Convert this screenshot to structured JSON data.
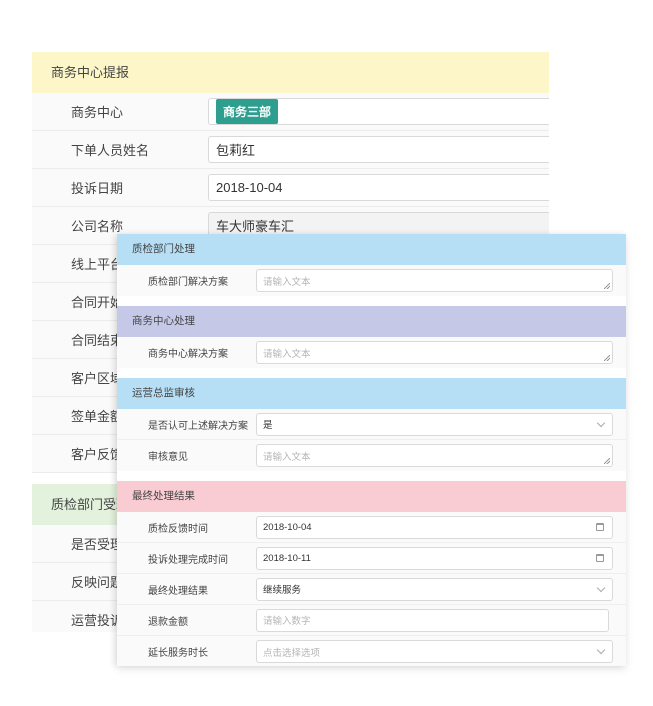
{
  "back_form": {
    "section1_title": "商务中心提报",
    "rows": [
      {
        "label": "商务中心",
        "badge": "商务三部"
      },
      {
        "label": "下单人员姓名",
        "value": "包莉红"
      },
      {
        "label": "投诉日期",
        "value": "2018-10-04"
      },
      {
        "label": "公司名称",
        "value": "车大师豪车汇"
      },
      {
        "label": "线上平台"
      },
      {
        "label": "合同开始"
      },
      {
        "label": "合同结束"
      },
      {
        "label": "客户区域"
      },
      {
        "label": "签单金额"
      },
      {
        "label": "客户反馈"
      }
    ],
    "section2_title": "质检部门受理",
    "rows2": [
      {
        "label": "是否受理"
      },
      {
        "label": "反映问题"
      },
      {
        "label": "运营投诉"
      }
    ]
  },
  "front_panel": {
    "qc": {
      "title": "质检部门处理",
      "solution_label": "质检部门解决方案",
      "solution_placeholder": "请输入文本"
    },
    "bc": {
      "title": "商务中心处理",
      "solution_label": "商务中心解决方案",
      "solution_placeholder": "请输入文本"
    },
    "ops": {
      "title": "运营总监审核",
      "approve_label": "是否认可上述解决方案",
      "approve_value": "是",
      "opinion_label": "审核意见",
      "opinion_placeholder": "请输入文本"
    },
    "final": {
      "title": "最终处理结果",
      "feedback_time_label": "质检反馈时间",
      "feedback_time_value": "2018-10-04",
      "complete_time_label": "投诉处理完成时间",
      "complete_time_value": "2018-10-11",
      "result_label": "最终处理结果",
      "result_value": "继续服务",
      "refund_label": "退款金额",
      "refund_placeholder": "请输入数字",
      "extend_label": "延长服务时长",
      "extend_placeholder": "点击选择选项"
    }
  }
}
